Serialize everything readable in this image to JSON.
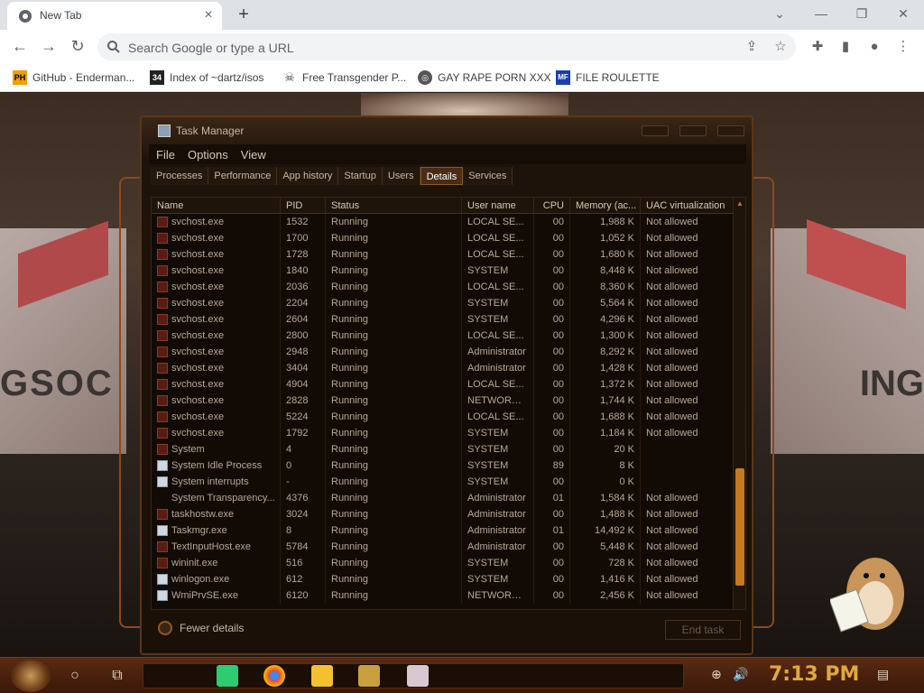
{
  "browser": {
    "tab_title": "New Tab",
    "tab_close": "×",
    "new_tab": "+",
    "omnibox_placeholder": "Search Google or type a URL",
    "bookmarks": [
      {
        "label": "GitHub - Enderman...",
        "icon": "PH",
        "color": "#f0a000"
      },
      {
        "label": "Index of ~dartz/isos",
        "icon": "34",
        "color": "#222222"
      },
      {
        "label": "Free Transgender P...",
        "icon": "☠",
        "color": "#444444"
      },
      {
        "label": "GAY RAPE PORN XXX",
        "icon": "🌐",
        "color": "#666666"
      },
      {
        "label": "FILE ROULETTE",
        "icon": "MF",
        "color": "#1a3fb0"
      }
    ]
  },
  "taskmanager": {
    "title": "Task Manager",
    "menu": [
      "File",
      "Options",
      "View"
    ],
    "tabs": [
      "Processes",
      "Performance",
      "App history",
      "Startup",
      "Users",
      "Details",
      "Services"
    ],
    "active_tab": "Details",
    "columns": [
      "Name",
      "PID",
      "Status",
      "User name",
      "CPU",
      "Memory (ac...",
      "UAC virtualization"
    ],
    "rows": [
      {
        "name": "svchost.exe",
        "pid": "1532",
        "status": "Running",
        "user": "LOCAL SE...",
        "cpu": "00",
        "mem": "1,988 K",
        "uac": "Not allowed",
        "icon": "svc"
      },
      {
        "name": "svchost.exe",
        "pid": "1700",
        "status": "Running",
        "user": "LOCAL SE...",
        "cpu": "00",
        "mem": "1,052 K",
        "uac": "Not allowed",
        "icon": "svc"
      },
      {
        "name": "svchost.exe",
        "pid": "1728",
        "status": "Running",
        "user": "LOCAL SE...",
        "cpu": "00",
        "mem": "1,680 K",
        "uac": "Not allowed",
        "icon": "svc"
      },
      {
        "name": "svchost.exe",
        "pid": "1840",
        "status": "Running",
        "user": "SYSTEM",
        "cpu": "00",
        "mem": "8,448 K",
        "uac": "Not allowed",
        "icon": "svc"
      },
      {
        "name": "svchost.exe",
        "pid": "2036",
        "status": "Running",
        "user": "LOCAL SE...",
        "cpu": "00",
        "mem": "8,360 K",
        "uac": "Not allowed",
        "icon": "svc"
      },
      {
        "name": "svchost.exe",
        "pid": "2204",
        "status": "Running",
        "user": "SYSTEM",
        "cpu": "00",
        "mem": "5,564 K",
        "uac": "Not allowed",
        "icon": "svc"
      },
      {
        "name": "svchost.exe",
        "pid": "2604",
        "status": "Running",
        "user": "SYSTEM",
        "cpu": "00",
        "mem": "4,296 K",
        "uac": "Not allowed",
        "icon": "svc"
      },
      {
        "name": "svchost.exe",
        "pid": "2800",
        "status": "Running",
        "user": "LOCAL SE...",
        "cpu": "00",
        "mem": "1,300 K",
        "uac": "Not allowed",
        "icon": "svc"
      },
      {
        "name": "svchost.exe",
        "pid": "2948",
        "status": "Running",
        "user": "Administrator",
        "cpu": "00",
        "mem": "8,292 K",
        "uac": "Not allowed",
        "icon": "svc"
      },
      {
        "name": "svchost.exe",
        "pid": "3404",
        "status": "Running",
        "user": "Administrator",
        "cpu": "00",
        "mem": "1,428 K",
        "uac": "Not allowed",
        "icon": "svc"
      },
      {
        "name": "svchost.exe",
        "pid": "4904",
        "status": "Running",
        "user": "LOCAL SE...",
        "cpu": "00",
        "mem": "1,372 K",
        "uac": "Not allowed",
        "icon": "svc"
      },
      {
        "name": "svchost.exe",
        "pid": "2828",
        "status": "Running",
        "user": "NETWORK ...",
        "cpu": "00",
        "mem": "1,744 K",
        "uac": "Not allowed",
        "icon": "svc"
      },
      {
        "name": "svchost.exe",
        "pid": "5224",
        "status": "Running",
        "user": "LOCAL SE...",
        "cpu": "00",
        "mem": "1,688 K",
        "uac": "Not allowed",
        "icon": "svc"
      },
      {
        "name": "svchost.exe",
        "pid": "1792",
        "status": "Running",
        "user": "SYSTEM",
        "cpu": "00",
        "mem": "1,184 K",
        "uac": "Not allowed",
        "icon": "svc"
      },
      {
        "name": "System",
        "pid": "4",
        "status": "Running",
        "user": "SYSTEM",
        "cpu": "00",
        "mem": "20 K",
        "uac": "",
        "icon": "svc"
      },
      {
        "name": "System Idle Process",
        "pid": "0",
        "status": "Running",
        "user": "SYSTEM",
        "cpu": "89",
        "mem": "8 K",
        "uac": "",
        "icon": "win"
      },
      {
        "name": "System interrupts",
        "pid": "-",
        "status": "Running",
        "user": "SYSTEM",
        "cpu": "00",
        "mem": "0 K",
        "uac": "",
        "icon": "win"
      },
      {
        "name": "System Transparency...",
        "pid": "4376",
        "status": "Running",
        "user": "Administrator",
        "cpu": "01",
        "mem": "1,584 K",
        "uac": "Not allowed",
        "icon": "none"
      },
      {
        "name": "taskhostw.exe",
        "pid": "3024",
        "status": "Running",
        "user": "Administrator",
        "cpu": "00",
        "mem": "1,488 K",
        "uac": "Not allowed",
        "icon": "svc"
      },
      {
        "name": "Taskmgr.exe",
        "pid": "8",
        "status": "Running",
        "user": "Administrator",
        "cpu": "01",
        "mem": "14,492 K",
        "uac": "Not allowed",
        "icon": "win"
      },
      {
        "name": "TextInputHost.exe",
        "pid": "5784",
        "status": "Running",
        "user": "Administrator",
        "cpu": "00",
        "mem": "5,448 K",
        "uac": "Not allowed",
        "icon": "svc"
      },
      {
        "name": "wininit.exe",
        "pid": "516",
        "status": "Running",
        "user": "SYSTEM",
        "cpu": "00",
        "mem": "728 K",
        "uac": "Not allowed",
        "icon": "svc"
      },
      {
        "name": "winlogon.exe",
        "pid": "612",
        "status": "Running",
        "user": "SYSTEM",
        "cpu": "00",
        "mem": "1,416 K",
        "uac": "Not allowed",
        "icon": "win"
      },
      {
        "name": "WmiPrvSE.exe",
        "pid": "6120",
        "status": "Running",
        "user": "NETWORK ...",
        "cpu": "00",
        "mem": "2,456 K",
        "uac": "Not allowed",
        "icon": "win"
      }
    ],
    "fewer_details": "Fewer details",
    "end_task": "End task"
  },
  "desktop": {
    "sign_left": "GSOC",
    "sign_right": "ING"
  },
  "taskbar": {
    "clock": "7:13 PM",
    "apps": [
      "spotify-icon",
      "chrome-icon",
      "file-explorer-icon",
      "game-icon",
      "photos-icon"
    ]
  }
}
